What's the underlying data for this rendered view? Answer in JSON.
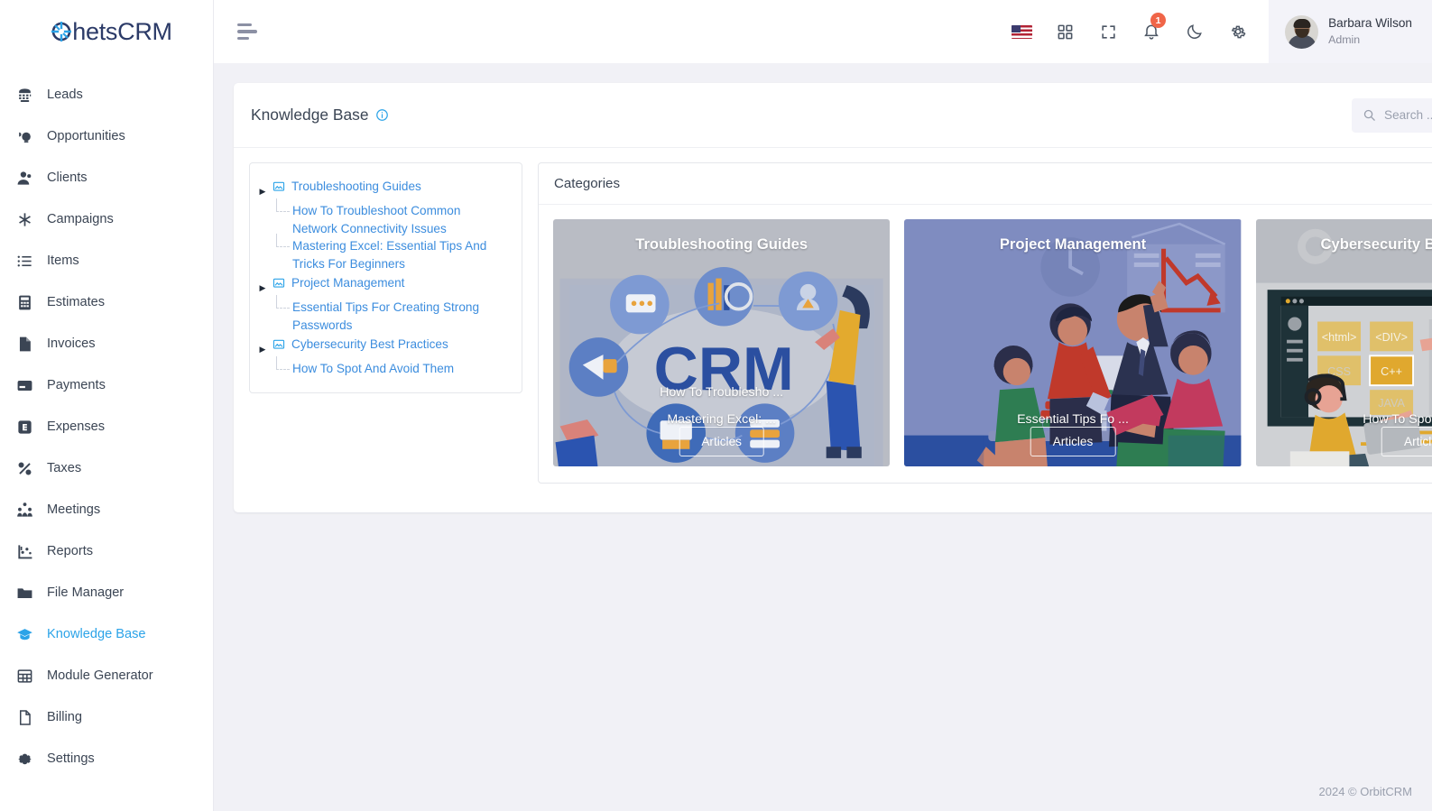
{
  "brand": {
    "name_prefix": "",
    "name": "hetsCRM",
    "full": "ChetsCRM",
    "accent": "#2ba3e8",
    "text_color": "#2b3a67"
  },
  "sidebar": {
    "items": [
      {
        "label": "Leads",
        "icon": "phone-icon",
        "active": false
      },
      {
        "label": "Opportunities",
        "icon": "lightbulb-icon",
        "active": false
      },
      {
        "label": "Clients",
        "icon": "user-icon",
        "active": false
      },
      {
        "label": "Campaigns",
        "icon": "asterisk-icon",
        "active": false
      },
      {
        "label": "Items",
        "icon": "list-icon",
        "active": false
      },
      {
        "label": "Estimates",
        "icon": "calculator-icon",
        "active": false
      },
      {
        "label": "Invoices",
        "icon": "file-icon",
        "active": false
      },
      {
        "label": "Payments",
        "icon": "card-icon",
        "active": false
      },
      {
        "label": "Expenses",
        "icon": "expense-icon",
        "active": false
      },
      {
        "label": "Taxes",
        "icon": "percent-icon",
        "active": false
      },
      {
        "label": "Meetings",
        "icon": "people-icon",
        "active": false
      },
      {
        "label": "Reports",
        "icon": "chart-icon",
        "active": false
      },
      {
        "label": "File Manager",
        "icon": "folder-icon",
        "active": false
      },
      {
        "label": "Knowledge Base",
        "icon": "graduation-cap-icon",
        "active": true
      },
      {
        "label": "Module Generator",
        "icon": "grid-icon",
        "active": false
      },
      {
        "label": "Billing",
        "icon": "document-icon",
        "active": false
      },
      {
        "label": "Settings",
        "icon": "gear-icon",
        "active": false
      }
    ]
  },
  "topbar": {
    "menu_toggle": "hamburger-icon",
    "icons": [
      {
        "name": "language-flag-icon",
        "label": "US"
      },
      {
        "name": "apps-grid-icon",
        "label": ""
      },
      {
        "name": "fullscreen-icon",
        "label": ""
      },
      {
        "name": "bell-icon",
        "label": "",
        "badge": "1"
      },
      {
        "name": "dark-mode-moon-icon",
        "label": ""
      },
      {
        "name": "gear-icon",
        "label": ""
      }
    ],
    "notification_count": "1",
    "user": {
      "name": "Barbara Wilson",
      "role": "Admin"
    }
  },
  "page": {
    "title": "Knowledge Base",
    "info_icon": "info-circle-icon",
    "search": {
      "placeholder": "Search ...",
      "value": ""
    },
    "search_button": "search-icon",
    "add_button": "plus-icon"
  },
  "tree": {
    "nodes": [
      {
        "label": "Troubleshooting Guides",
        "children": [
          "How To Troubleshoot Common Network Connectivity Issues",
          "Mastering Excel: Essential Tips And Tricks For Beginners"
        ]
      },
      {
        "label": "Project Management",
        "children": [
          "Essential Tips For Creating Strong Passwords"
        ]
      },
      {
        "label": "Cybersecurity Best Practices",
        "children": [
          "How To Spot And Avoid Them"
        ]
      }
    ]
  },
  "categories": {
    "heading": "Categories",
    "cards": [
      {
        "title": "Troubleshooting Guides",
        "articles": [
          "How To Troublesho ...",
          "Mastering Excel: ..."
        ],
        "button": "Articles",
        "theme": "crm-illustration"
      },
      {
        "title": "Project Management",
        "articles": [
          "Essential Tips Fo ..."
        ],
        "button": "Articles",
        "theme": "team-illustration"
      },
      {
        "title": "Cybersecurity Best Practices",
        "articles": [
          "How To Spot And A ..."
        ],
        "button": "Articles",
        "theme": "coding-illustration"
      }
    ]
  },
  "footer": {
    "text": "2024 © OrbitCRM"
  }
}
